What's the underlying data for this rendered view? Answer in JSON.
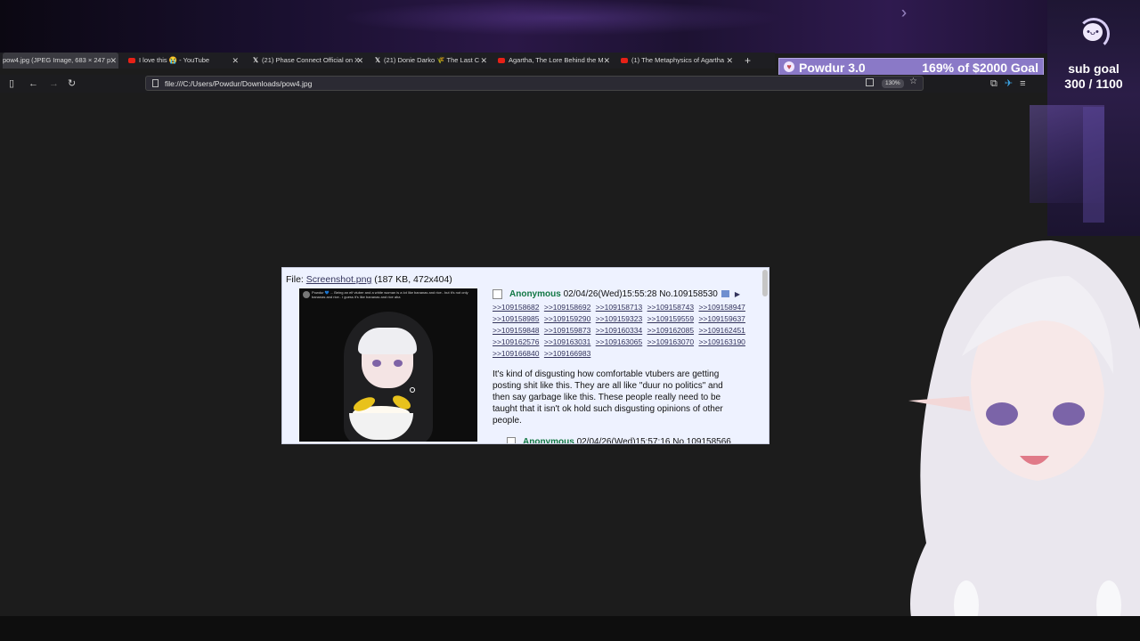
{
  "stream": {
    "goal_name": "Powdur 3.0",
    "goal_progress_text": "169% of $2000 Goal",
    "goal_progress_fraction": 1.0,
    "sub_goal_title": "sub goal",
    "sub_goal_count": "300 / 1100"
  },
  "browser": {
    "tabs": [
      {
        "label": "pow4.jpg (JPEG Image, 683 × 247 p",
        "favicon_color": "#777777",
        "active": true
      },
      {
        "label": "I love this 😭 - YouTube",
        "favicon_color": "#e62117",
        "active": false
      },
      {
        "label": "(21) Phase Connect Official on X",
        "favicon_color": "#ffffff",
        "active": false
      },
      {
        "label": "(21) Donie Darko 🌾 The Last C",
        "favicon_color": "#ffffff",
        "active": false
      },
      {
        "label": "Agartha, The Lore Behind the M",
        "favicon_color": "#e62117",
        "active": false
      },
      {
        "label": "(1) The Metaphysics of Agartha",
        "favicon_color": "#e62117",
        "active": false
      }
    ],
    "new_tab_label": "+",
    "url": "file:///C:/Users/Powdur/Downloads/pow4.jpg",
    "zoom": "130%"
  },
  "post": {
    "file_prefix": "File:",
    "file_name": "Screenshot.png",
    "file_info": "(187 KB, 472x404)",
    "thumb_text": "Powdur 💙 ... Being an elf vtuber and a white woman is a lot like bananas and rice.. but it's not only bananas and rice.. I guess it's like bananas and rice aha",
    "name": "Anonymous",
    "datetime": "02/04/26(Wed)15:55:28",
    "post_no": "No.109158530",
    "replies": [
      ">>109158682",
      ">>109158692",
      ">>109158713",
      ">>109158743",
      ">>109158947",
      ">>109158985",
      ">>109159290",
      ">>109159323",
      ">>109159559",
      ">>109159637",
      ">>109159848",
      ">>109159873",
      ">>109160334",
      ">>109162085",
      ">>109162451",
      ">>109162576",
      ">>109163031",
      ">>109163065",
      ">>109163070",
      ">>109163190",
      ">>109166840",
      ">>109166983"
    ],
    "body": "It's kind of disgusting how comfortable vtubers are getting posting shit like this. They are all like \"duur no politics\" and then say garbage like this. These people really need to be taught that it isn't ok hold such disgusting opinions of other people.",
    "next_name": "Anonymous",
    "next_meta": "02/04/26(Wed)15:57:16 No.109158566"
  },
  "colors": {
    "accent_purple": "#8a79c7",
    "anon_green": "#117743",
    "link_blue": "#34345c",
    "post_bg": "#eef2ff"
  },
  "icons": [
    "sidebar-icon",
    "back-icon",
    "forward-icon",
    "reload-icon",
    "document-icon",
    "download-icon",
    "star-icon",
    "extension-icon",
    "menu-icon"
  ]
}
